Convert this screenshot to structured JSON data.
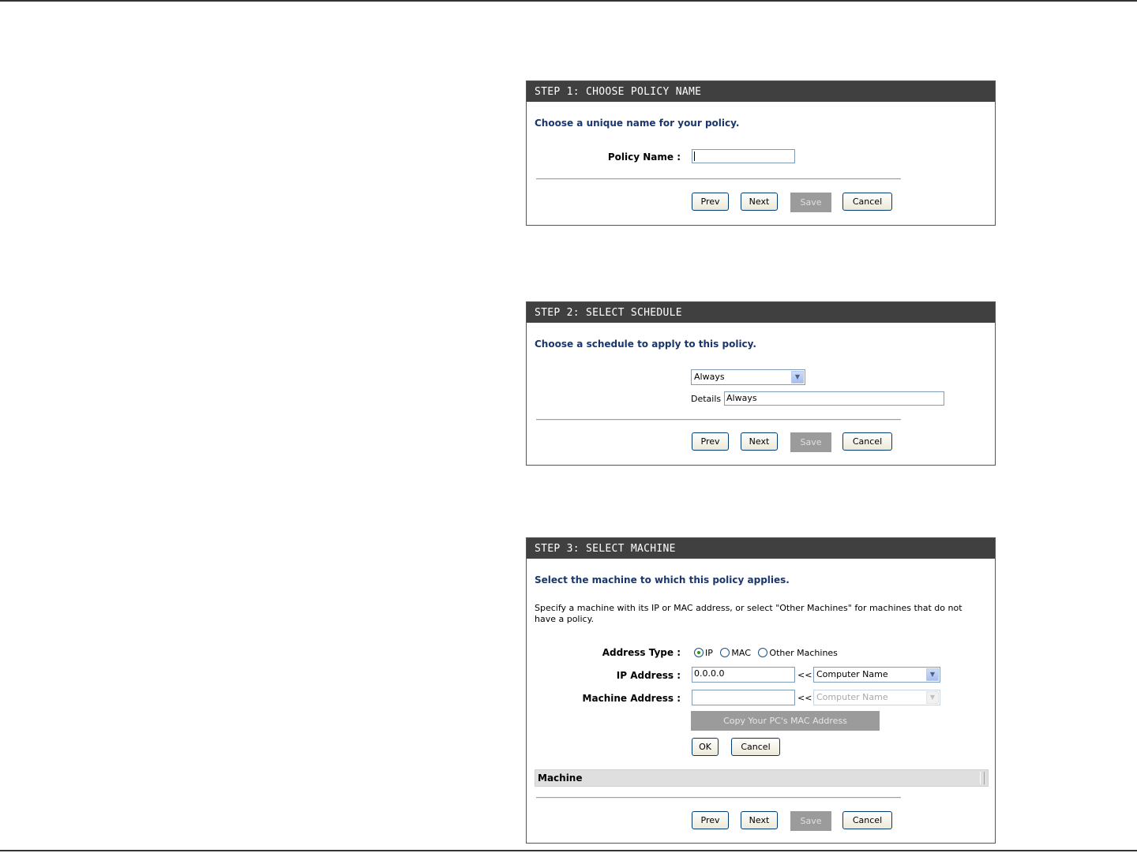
{
  "step1": {
    "header": "STEP 1: CHOOSE POLICY NAME",
    "subtitle": "Choose a unique name for your policy.",
    "policy_name_label": "Policy Name :",
    "policy_name_value": "",
    "buttons": {
      "prev": "Prev",
      "next": "Next",
      "save": "Save",
      "cancel": "Cancel"
    }
  },
  "step2": {
    "header": "STEP 2: SELECT SCHEDULE",
    "subtitle": "Choose a schedule to apply to this policy.",
    "schedule_selected": "Always",
    "details_label": "Details :",
    "details_value": "Always",
    "buttons": {
      "prev": "Prev",
      "next": "Next",
      "save": "Save",
      "cancel": "Cancel"
    }
  },
  "step3": {
    "header": "STEP 3: SELECT MACHINE",
    "subtitle": "Select the machine to which this policy applies.",
    "description": "Specify a machine with its IP or MAC address, or select \"Other Machines\" for machines that do not have a policy.",
    "address_type_label": "Address Type :",
    "address_types": [
      "IP",
      "MAC",
      "Other Machines"
    ],
    "address_type_selected": "IP",
    "ip_address_label": "IP Address :",
    "ip_address_value": "0.0.0.0",
    "machine_address_label": "Machine Address :",
    "machine_address_value": "",
    "arrow_text": "<<",
    "computer_name_select": "Computer Name",
    "computer_name_select_disabled": "Computer Name",
    "copy_mac_button": "Copy Your PC's MAC Address",
    "ok_button": "OK",
    "cancel_small_button": "Cancel",
    "table_column": "Machine",
    "buttons": {
      "prev": "Prev",
      "next": "Next",
      "save": "Save",
      "cancel": "Cancel"
    }
  },
  "colors": {
    "header_bg": "#404040",
    "subtitle_blue": "#19366d",
    "disabled_gray": "#9b9b9b"
  }
}
